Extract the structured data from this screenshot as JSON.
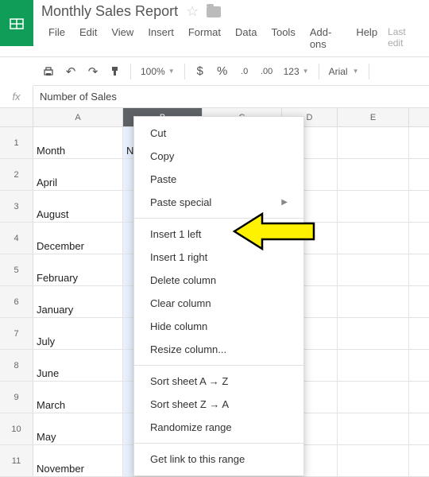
{
  "doc": {
    "title": "Monthly Sales Report",
    "last_edit": "Last edit"
  },
  "menubar": {
    "file": "File",
    "edit": "Edit",
    "view": "View",
    "insert": "Insert",
    "format": "Format",
    "data": "Data",
    "tools": "Tools",
    "addons": "Add-ons",
    "help": "Help"
  },
  "toolbar": {
    "zoom": "100%",
    "dollar": "$",
    "percent": "%",
    "dec_dec": ".0",
    "dec_inc": ".00",
    "num123": "123",
    "font": "Arial"
  },
  "formula": {
    "fx": "fx",
    "value": "Number of Sales"
  },
  "columns": {
    "a": "A",
    "b": "B",
    "c": "C",
    "d": "D",
    "e": "E"
  },
  "rows": [
    "1",
    "2",
    "3",
    "4",
    "5",
    "6",
    "7",
    "8",
    "9",
    "10",
    "11"
  ],
  "cells": {
    "a": [
      "Month",
      "April",
      "August",
      "December",
      "February",
      "January",
      "July",
      "June",
      "March",
      "May",
      "November"
    ],
    "b_header": "Num"
  },
  "context_menu": {
    "cut": "Cut",
    "copy": "Copy",
    "paste": "Paste",
    "paste_special": "Paste special",
    "insert_left": "Insert 1 left",
    "insert_right": "Insert 1 right",
    "delete_col": "Delete column",
    "clear_col": "Clear column",
    "hide_col": "Hide column",
    "resize_col": "Resize column...",
    "sort_az": "Sort sheet A → Z",
    "sort_za": "Sort sheet Z → A",
    "randomize": "Randomize range",
    "get_link": "Get link to this range"
  }
}
